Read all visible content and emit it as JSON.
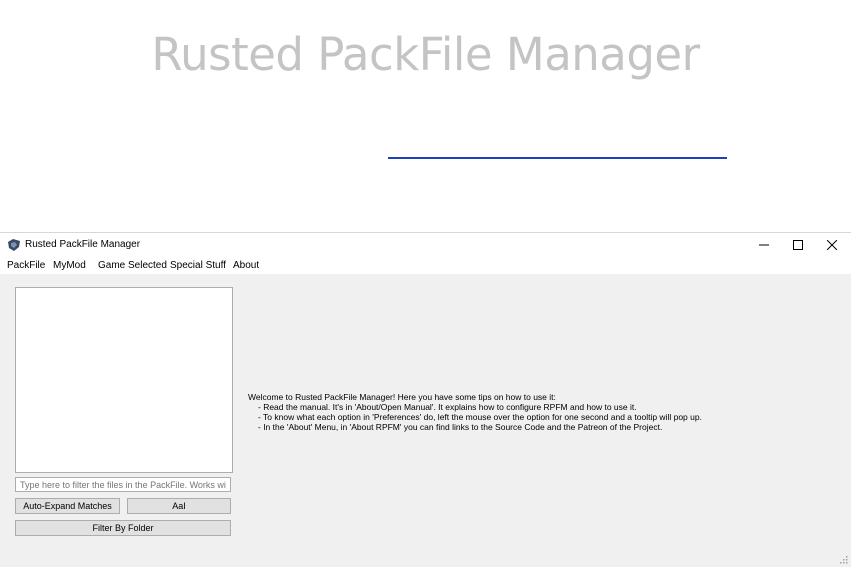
{
  "banner": {
    "title": "Rusted PackFile Manager"
  },
  "window": {
    "title": "Rusted PackFile Manager",
    "controls": {
      "minimize": "—",
      "maximize": "☐",
      "close": "✕"
    }
  },
  "menu": {
    "items": [
      "PackFile",
      "MyMod",
      "Game Selected",
      "Special Stuff",
      "About"
    ]
  },
  "sidebar": {
    "filter_placeholder": "Type here to filter the files in the PackFile. Works with ...",
    "auto_expand_label": "Auto-Expand Matches",
    "case_sensitive_label": "AaI",
    "filter_by_folder_label": "Filter By Folder"
  },
  "welcome": {
    "intro": "Welcome to Rusted PackFile Manager! Here you have some tips on how to use it:",
    "tips": [
      "- Read the manual. It's in 'About/Open Manual'. It explains how to configure RPFM and how to use it.",
      "- To know what each option in 'Preferences' do, left the mouse over the option for one second and a tooltip will pop up.",
      "- In the 'About' Menu, in 'About RPFM' you can find links to the Source Code and the Patreon of the Project."
    ]
  },
  "colors": {
    "banner_title": "#c4c4c4",
    "link_underline": "#1f3fbf",
    "window_bg": "#f0f0f0",
    "button_bg": "#e1e1e1"
  }
}
